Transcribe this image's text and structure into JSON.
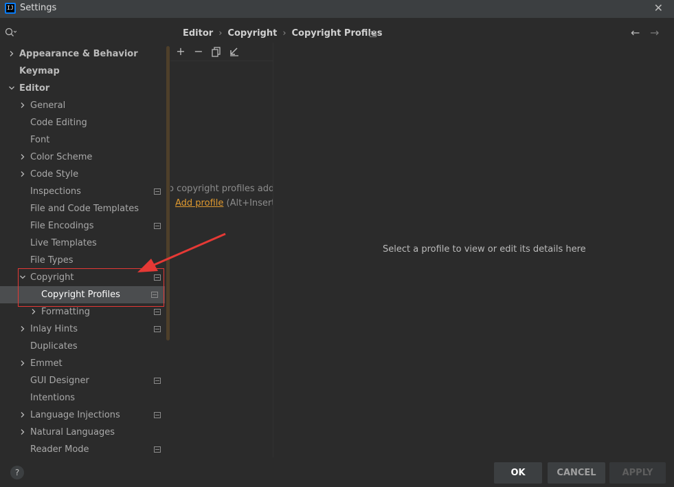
{
  "window": {
    "title": "Settings",
    "app_icon": "intellij-icon",
    "close_icon": "close-icon"
  },
  "search": {
    "placeholder": "",
    "icon": "search-icon"
  },
  "sidebar": {
    "items": [
      {
        "label": "Appearance & Behavior",
        "level": 0,
        "expandable": true,
        "expanded": false,
        "bold": true,
        "project_icon": false
      },
      {
        "label": "Keymap",
        "level": 0,
        "expandable": false,
        "bold": true,
        "project_icon": false
      },
      {
        "label": "Editor",
        "level": 0,
        "expandable": true,
        "expanded": true,
        "bold": true,
        "project_icon": false
      },
      {
        "label": "General",
        "level": 1,
        "expandable": true,
        "expanded": false,
        "project_icon": false
      },
      {
        "label": "Code Editing",
        "level": 1,
        "expandable": false,
        "project_icon": false
      },
      {
        "label": "Font",
        "level": 1,
        "expandable": false,
        "project_icon": false
      },
      {
        "label": "Color Scheme",
        "level": 1,
        "expandable": true,
        "expanded": false,
        "project_icon": false
      },
      {
        "label": "Code Style",
        "level": 1,
        "expandable": true,
        "expanded": false,
        "project_icon": false
      },
      {
        "label": "Inspections",
        "level": 1,
        "expandable": false,
        "project_icon": true
      },
      {
        "label": "File and Code Templates",
        "level": 1,
        "expandable": false,
        "project_icon": false
      },
      {
        "label": "File Encodings",
        "level": 1,
        "expandable": false,
        "project_icon": true
      },
      {
        "label": "Live Templates",
        "level": 1,
        "expandable": false,
        "project_icon": false
      },
      {
        "label": "File Types",
        "level": 1,
        "expandable": false,
        "project_icon": false
      },
      {
        "label": "Copyright",
        "level": 1,
        "expandable": true,
        "expanded": true,
        "project_icon": true
      },
      {
        "label": "Copyright Profiles",
        "level": 2,
        "expandable": false,
        "selected": true,
        "project_icon": true
      },
      {
        "label": "Formatting",
        "level": 2,
        "expandable": true,
        "expanded": false,
        "project_icon": true
      },
      {
        "label": "Inlay Hints",
        "level": 1,
        "expandable": true,
        "expanded": false,
        "project_icon": true
      },
      {
        "label": "Duplicates",
        "level": 1,
        "expandable": false,
        "project_icon": false
      },
      {
        "label": "Emmet",
        "level": 1,
        "expandable": true,
        "expanded": false,
        "project_icon": false
      },
      {
        "label": "GUI Designer",
        "level": 1,
        "expandable": false,
        "project_icon": true
      },
      {
        "label": "Intentions",
        "level": 1,
        "expandable": false,
        "project_icon": false
      },
      {
        "label": "Language Injections",
        "level": 1,
        "expandable": true,
        "expanded": false,
        "project_icon": true
      },
      {
        "label": "Natural Languages",
        "level": 1,
        "expandable": true,
        "expanded": false,
        "project_icon": false
      },
      {
        "label": "Reader Mode",
        "level": 1,
        "expandable": false,
        "project_icon": true
      }
    ]
  },
  "breadcrumb": {
    "items": [
      "Editor",
      "Copyright",
      "Copyright Profiles"
    ],
    "separator": "›"
  },
  "nav": {
    "back_icon": "arrow-left-icon",
    "forward_icon": "arrow-right-icon"
  },
  "profiles_list": {
    "toolbar": [
      "add-icon",
      "remove-icon",
      "copy-icon",
      "import-icon"
    ],
    "empty_text": "o copyright profiles adde",
    "add_link": "Add profile",
    "shortcut": "(Alt+Insert)"
  },
  "details": {
    "empty_text": "Select a profile to view or edit its details here"
  },
  "footer": {
    "help_label": "?",
    "ok_label": "OK",
    "cancel_label": "CANCEL",
    "apply_label": "APPLY"
  },
  "colors": {
    "accent_link": "#e09a2f",
    "annotation_red": "#e53935",
    "selection": "#4b4d4f"
  }
}
